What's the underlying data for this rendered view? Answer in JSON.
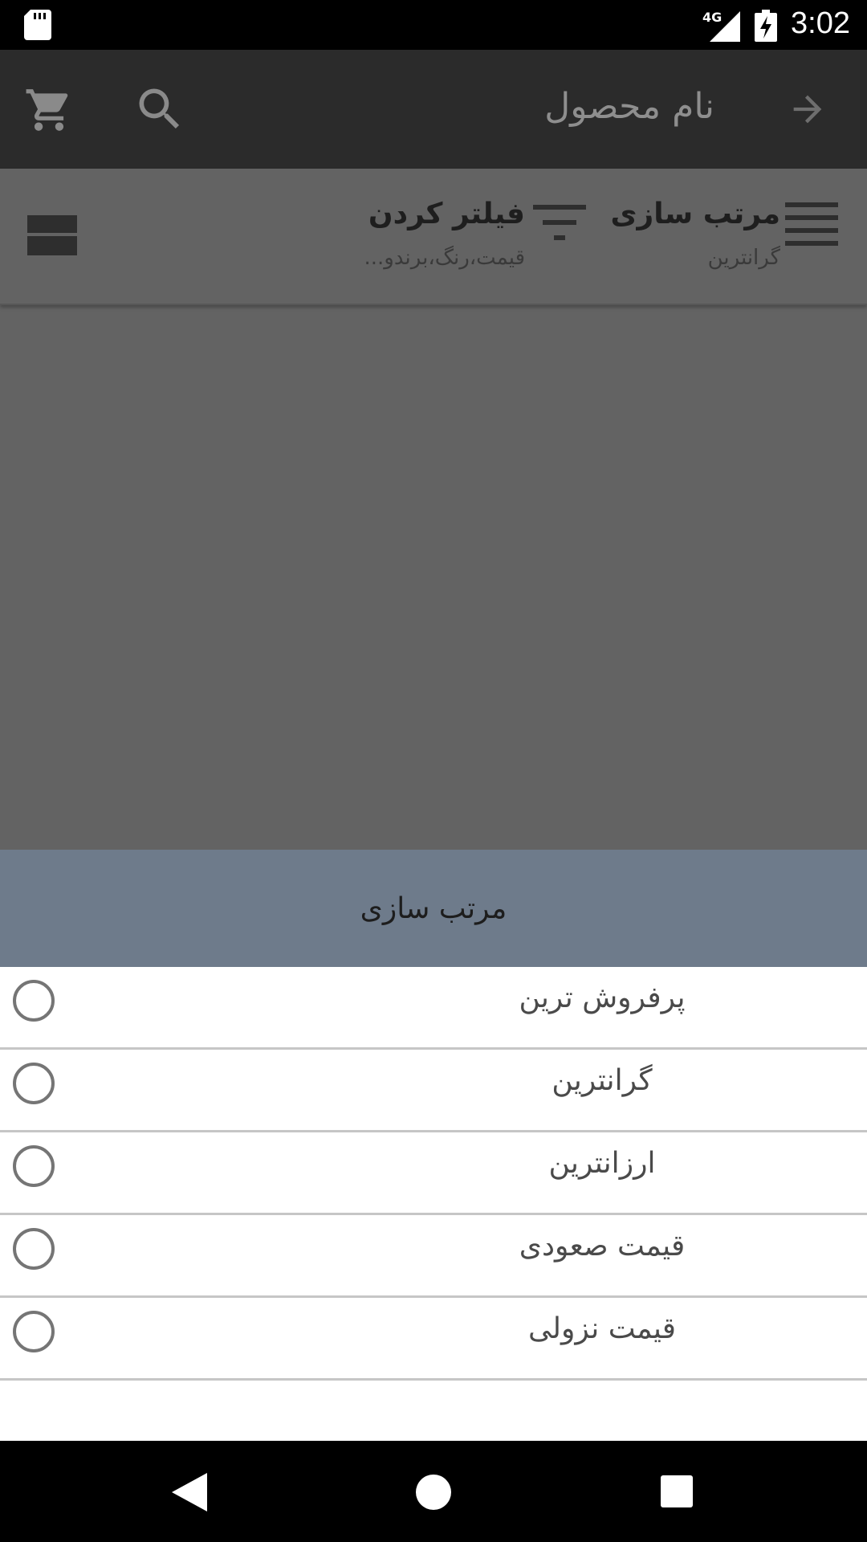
{
  "status_bar": {
    "network": "4G",
    "time": "3:02"
  },
  "app_bar": {
    "title": "نام محصول",
    "icons": [
      "arrow-back-icon",
      "search-icon",
      "cart-icon"
    ]
  },
  "toolbar": {
    "sort": {
      "title": "مرتب سازی",
      "subtitle": "گرانترین"
    },
    "filter": {
      "title": "فیلتر کردن",
      "subtitle": "قیمت،رنگ،برندو..."
    },
    "layout_icon": "view-stream-icon"
  },
  "sort_sheet": {
    "title": "مرتب سازی",
    "header_color": "#6e7b8b",
    "options": [
      {
        "label": "پرفروش ترین",
        "selected": false
      },
      {
        "label": "گرانترین",
        "selected": false
      },
      {
        "label": "ارزانترین",
        "selected": false
      },
      {
        "label": "قیمت صعودی",
        "selected": false
      },
      {
        "label": "قیمت نزولی",
        "selected": false
      }
    ]
  },
  "nav_bar": {
    "icons": [
      "nav-back-icon",
      "nav-home-icon",
      "nav-recents-icon"
    ]
  }
}
